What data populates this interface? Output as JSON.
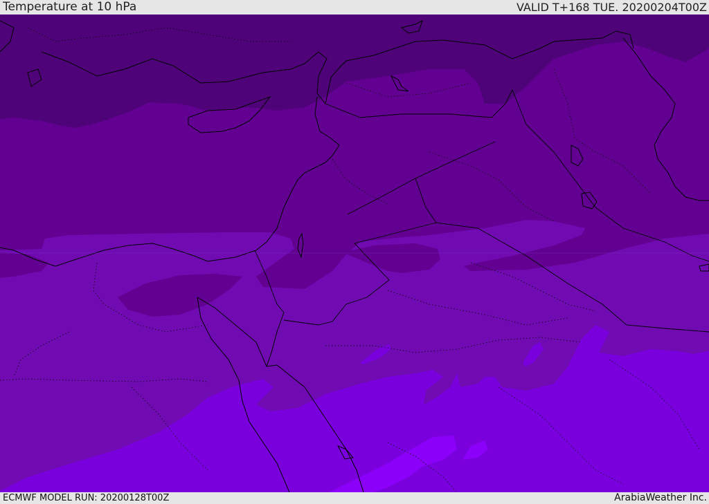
{
  "header": {
    "title": "Temperature at 10 hPa",
    "valid": "VALID T+168 TUE. 20200204T00Z"
  },
  "footer": {
    "model_run": "ECMWF MODEL RUN: 20200128T00Z",
    "credit": "ArabiaWeather Inc."
  },
  "colors": {
    "band_darkest": "#4f0378",
    "band_dark": "#610091",
    "band_mid": "#6f0bb0",
    "band_light": "#7900dc",
    "band_lightest": "#8a00f8",
    "boundary": "#000000"
  }
}
